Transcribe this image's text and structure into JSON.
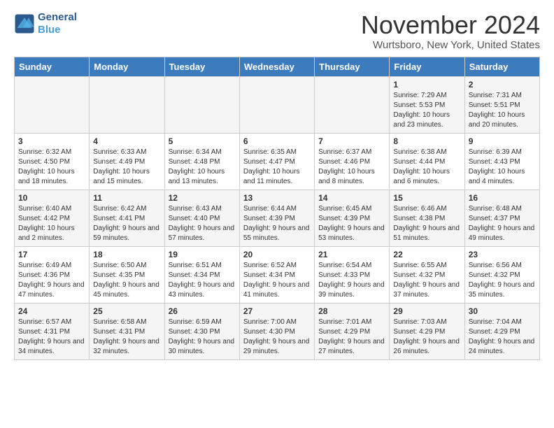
{
  "header": {
    "logo_line1": "General",
    "logo_line2": "Blue",
    "month": "November 2024",
    "location": "Wurtsboro, New York, United States"
  },
  "weekdays": [
    "Sunday",
    "Monday",
    "Tuesday",
    "Wednesday",
    "Thursday",
    "Friday",
    "Saturday"
  ],
  "weeks": [
    [
      {
        "day": "",
        "info": ""
      },
      {
        "day": "",
        "info": ""
      },
      {
        "day": "",
        "info": ""
      },
      {
        "day": "",
        "info": ""
      },
      {
        "day": "",
        "info": ""
      },
      {
        "day": "1",
        "info": "Sunrise: 7:29 AM\nSunset: 5:53 PM\nDaylight: 10 hours and 23 minutes."
      },
      {
        "day": "2",
        "info": "Sunrise: 7:31 AM\nSunset: 5:51 PM\nDaylight: 10 hours and 20 minutes."
      }
    ],
    [
      {
        "day": "3",
        "info": "Sunrise: 6:32 AM\nSunset: 4:50 PM\nDaylight: 10 hours and 18 minutes."
      },
      {
        "day": "4",
        "info": "Sunrise: 6:33 AM\nSunset: 4:49 PM\nDaylight: 10 hours and 15 minutes."
      },
      {
        "day": "5",
        "info": "Sunrise: 6:34 AM\nSunset: 4:48 PM\nDaylight: 10 hours and 13 minutes."
      },
      {
        "day": "6",
        "info": "Sunrise: 6:35 AM\nSunset: 4:47 PM\nDaylight: 10 hours and 11 minutes."
      },
      {
        "day": "7",
        "info": "Sunrise: 6:37 AM\nSunset: 4:46 PM\nDaylight: 10 hours and 8 minutes."
      },
      {
        "day": "8",
        "info": "Sunrise: 6:38 AM\nSunset: 4:44 PM\nDaylight: 10 hours and 6 minutes."
      },
      {
        "day": "9",
        "info": "Sunrise: 6:39 AM\nSunset: 4:43 PM\nDaylight: 10 hours and 4 minutes."
      }
    ],
    [
      {
        "day": "10",
        "info": "Sunrise: 6:40 AM\nSunset: 4:42 PM\nDaylight: 10 hours and 2 minutes."
      },
      {
        "day": "11",
        "info": "Sunrise: 6:42 AM\nSunset: 4:41 PM\nDaylight: 9 hours and 59 minutes."
      },
      {
        "day": "12",
        "info": "Sunrise: 6:43 AM\nSunset: 4:40 PM\nDaylight: 9 hours and 57 minutes."
      },
      {
        "day": "13",
        "info": "Sunrise: 6:44 AM\nSunset: 4:39 PM\nDaylight: 9 hours and 55 minutes."
      },
      {
        "day": "14",
        "info": "Sunrise: 6:45 AM\nSunset: 4:39 PM\nDaylight: 9 hours and 53 minutes."
      },
      {
        "day": "15",
        "info": "Sunrise: 6:46 AM\nSunset: 4:38 PM\nDaylight: 9 hours and 51 minutes."
      },
      {
        "day": "16",
        "info": "Sunrise: 6:48 AM\nSunset: 4:37 PM\nDaylight: 9 hours and 49 minutes."
      }
    ],
    [
      {
        "day": "17",
        "info": "Sunrise: 6:49 AM\nSunset: 4:36 PM\nDaylight: 9 hours and 47 minutes."
      },
      {
        "day": "18",
        "info": "Sunrise: 6:50 AM\nSunset: 4:35 PM\nDaylight: 9 hours and 45 minutes."
      },
      {
        "day": "19",
        "info": "Sunrise: 6:51 AM\nSunset: 4:34 PM\nDaylight: 9 hours and 43 minutes."
      },
      {
        "day": "20",
        "info": "Sunrise: 6:52 AM\nSunset: 4:34 PM\nDaylight: 9 hours and 41 minutes."
      },
      {
        "day": "21",
        "info": "Sunrise: 6:54 AM\nSunset: 4:33 PM\nDaylight: 9 hours and 39 minutes."
      },
      {
        "day": "22",
        "info": "Sunrise: 6:55 AM\nSunset: 4:32 PM\nDaylight: 9 hours and 37 minutes."
      },
      {
        "day": "23",
        "info": "Sunrise: 6:56 AM\nSunset: 4:32 PM\nDaylight: 9 hours and 35 minutes."
      }
    ],
    [
      {
        "day": "24",
        "info": "Sunrise: 6:57 AM\nSunset: 4:31 PM\nDaylight: 9 hours and 34 minutes."
      },
      {
        "day": "25",
        "info": "Sunrise: 6:58 AM\nSunset: 4:31 PM\nDaylight: 9 hours and 32 minutes."
      },
      {
        "day": "26",
        "info": "Sunrise: 6:59 AM\nSunset: 4:30 PM\nDaylight: 9 hours and 30 minutes."
      },
      {
        "day": "27",
        "info": "Sunrise: 7:00 AM\nSunset: 4:30 PM\nDaylight: 9 hours and 29 minutes."
      },
      {
        "day": "28",
        "info": "Sunrise: 7:01 AM\nSunset: 4:29 PM\nDaylight: 9 hours and 27 minutes."
      },
      {
        "day": "29",
        "info": "Sunrise: 7:03 AM\nSunset: 4:29 PM\nDaylight: 9 hours and 26 minutes."
      },
      {
        "day": "30",
        "info": "Sunrise: 7:04 AM\nSunset: 4:29 PM\nDaylight: 9 hours and 24 minutes."
      }
    ]
  ]
}
